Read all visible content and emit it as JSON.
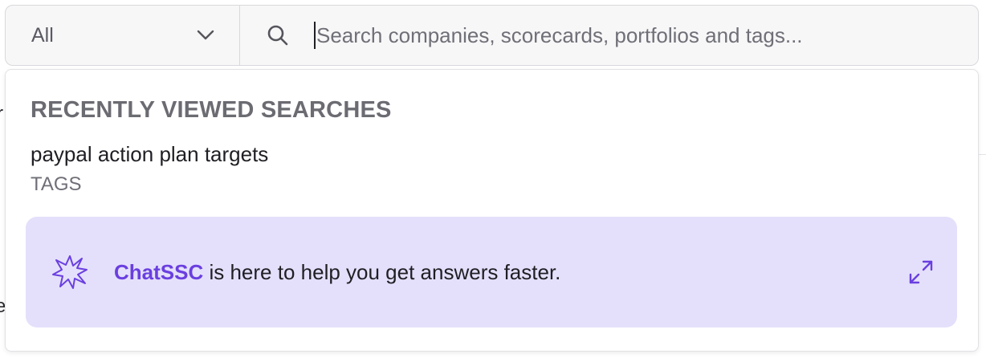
{
  "search": {
    "scope_value": "All",
    "placeholder": "Search companies, scorecards, portfolios and tags..."
  },
  "dropdown": {
    "recent_heading": "RECENTLY VIEWED SEARCHES",
    "recent_items": [
      {
        "name": "paypal action plan targets",
        "type": "TAGS"
      }
    ]
  },
  "chat_banner": {
    "link_text": "ChatSSC",
    "message": " is here to help you get answers faster."
  },
  "colors": {
    "accent": "#6a3fe0",
    "banner_bg": "#e4e0fb"
  },
  "icons": {
    "scope": "chevron-down-icon",
    "search": "search-icon",
    "spark": "sparkle-icon",
    "expand": "expand-icon"
  }
}
